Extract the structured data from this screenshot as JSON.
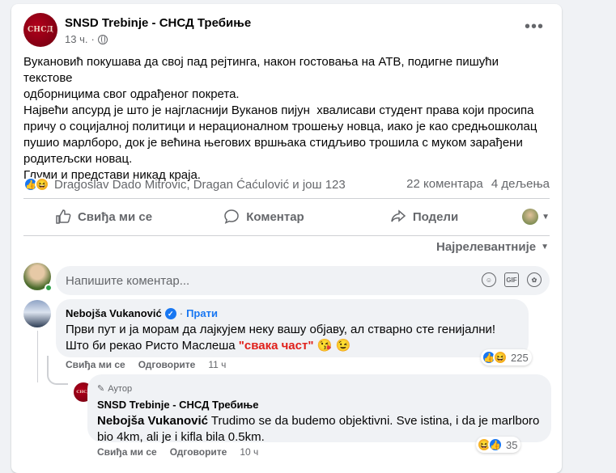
{
  "post": {
    "page_name": "SNSD Trebinje - СНСД Требиње",
    "logo_text": "СНСД",
    "time": "13 ч.",
    "more": "•••",
    "text_lines": [
      "Вукановић покушава да свој пад рејтинга, након гостовања на АТВ, подигне пишући текстове",
      "одборницима свог одрађеног покрета.",
      "Највећи апсурд је што је најгласнији Вуканов пијун  хвалисави студент права који просипа",
      "причу о социјалној политици и нерационалном трошењу новца, иако је као средњошколац",
      "пушио марлборо, док је већина његових вршњака стидљиво трошила с муком зарађени",
      "родитељски новац.",
      "Глуми и представи никад краја."
    ]
  },
  "reactions": {
    "names": "Dragoslav Dado Mitrovic, Dragan Ćaćulović и још 123",
    "comments": "22 коментара",
    "shares": "4 дељења"
  },
  "actions": {
    "like": "Свиђа ми се",
    "comment": "Коментар",
    "share": "Подели"
  },
  "sort_label": "Најрелевантније",
  "composer": {
    "placeholder": "Напишите коментар..."
  },
  "comments": [
    {
      "author": "Nebojša Vukanović",
      "follow": "Прати",
      "text_before": "Први пут и ја морам да лајкујем неку вашу објаву, ал стварно сте генијални! Што би рекао Ристо Маслеша ",
      "highlight": "\"свака част\"",
      "emojis": "😘 😉",
      "like": "Свиђа ми се",
      "reply": "Одговорите",
      "time": "11 ч",
      "reaction_count": "225"
    },
    {
      "badge": "Аутор",
      "author": "SNSD Trebinje - СНСД Требиње",
      "mention": "Nebojša Vukanović",
      "text": " Trudimo se da budemo objektivni. Sve istina, i da je marlboro bio 4km, ali je i kifla bila 0.5km.",
      "like": "Свиђа ми се",
      "reply": "Одговорите",
      "time": "10 ч",
      "reaction_count": "35"
    }
  ],
  "colors": {
    "accent": "#1877f2",
    "highlight": "#e0201b",
    "muted": "#65676b"
  }
}
